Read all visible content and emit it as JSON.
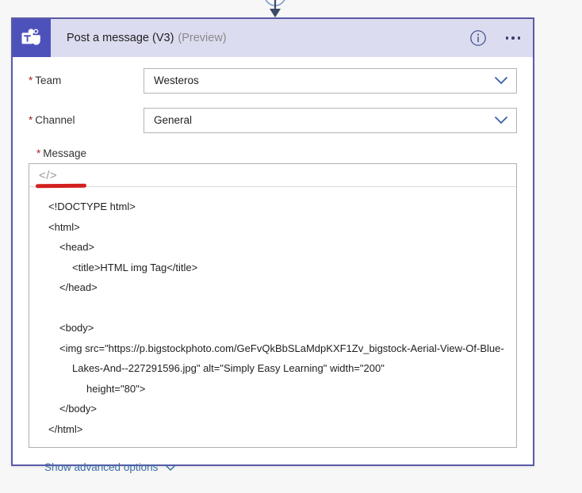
{
  "connector": {
    "arrow_icon": "down-arrow-icon",
    "node_icon": "connector-node-icon",
    "color": "#3b4a66"
  },
  "card": {
    "border_color": "#5a5aa8",
    "header": {
      "app_icon": "microsoft-teams-icon",
      "icon_tile_color": "#4d52bb",
      "background": "#dcdcf0",
      "title": "Post a message (V3)",
      "subtitle": "(Preview)",
      "info_icon": "info-circle-icon",
      "more_icon": "ellipsis-icon"
    },
    "fields": [
      {
        "label": "Team",
        "required_marker": "*",
        "value": "Westeros",
        "chevron_icon": "chevron-down-icon"
      },
      {
        "label": "Channel",
        "required_marker": "*",
        "value": "General",
        "chevron_icon": "chevron-down-icon"
      }
    ],
    "message": {
      "label": "Message",
      "required_marker": "*",
      "toolbar": {
        "code_view_label": "</>",
        "code_view_icon": "code-view-icon"
      },
      "code_lines": [
        {
          "text": "<!DOCTYPE html>",
          "indent": "ind-0"
        },
        {
          "text": "<html>",
          "indent": "ind-0"
        },
        {
          "text": "<head>",
          "indent": "ind-1"
        },
        {
          "text": "<title>HTML img Tag</title>",
          "indent": "ind-2"
        },
        {
          "text": "</head>",
          "indent": "ind-1"
        },
        {
          "text": "",
          "indent": "ind-0"
        },
        {
          "text": "<body>",
          "indent": "ind-1"
        },
        {
          "text": "<img src=\"https://p.bigstockphoto.com/GeFvQkBbSLaMdpKXF1Zv_bigstock-Aerial-View-Of-Blue-Lakes-And--227291596.jpg\" alt=\"Simply Easy Learning\" width=\"200\"",
          "indent": "ind-wrap"
        },
        {
          "text": "height=\"80\">",
          "indent": "ind-3"
        },
        {
          "text": "</body>",
          "indent": "ind-1"
        },
        {
          "text": "</html>",
          "indent": "ind-0"
        }
      ]
    },
    "footer": {
      "advanced_options_label": "Show advanced options",
      "chevron_icon": "chevron-down-icon",
      "link_color": "#3a6ea8"
    }
  },
  "annotation": {
    "type": "red-underline-mark",
    "color": "#d32020"
  }
}
